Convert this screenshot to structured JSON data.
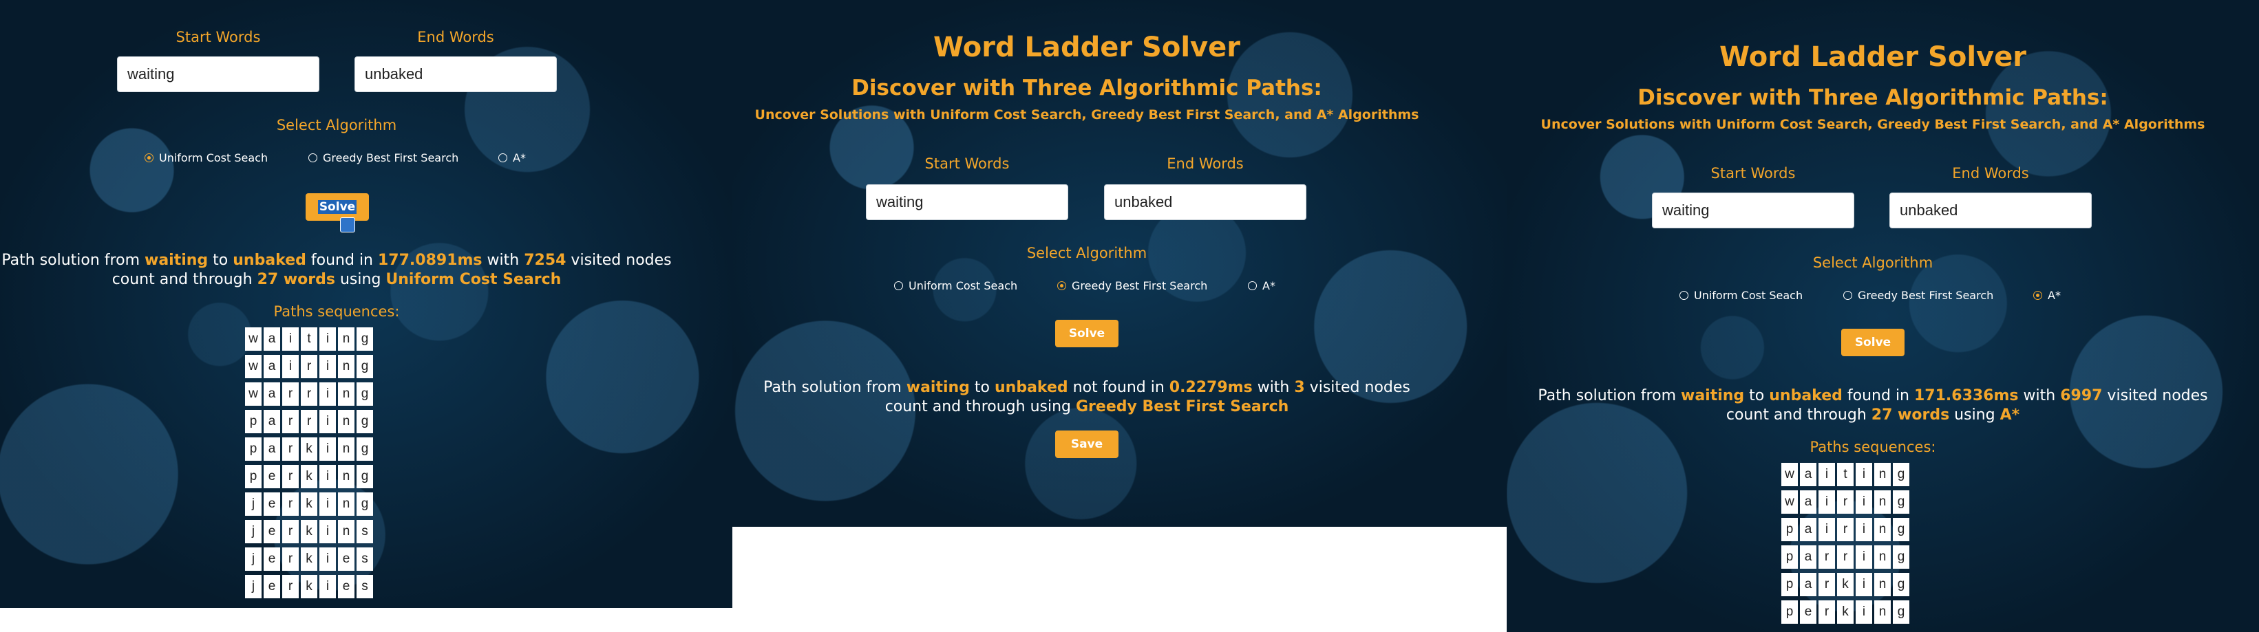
{
  "panel1": {
    "start_label": "Start Words",
    "end_label": "End Words",
    "start_value": "waiting",
    "end_value": "unbaked",
    "select_label": "Select Algorithm",
    "radios": [
      {
        "label": "Uniform Cost Seach",
        "checked": true
      },
      {
        "label": "Greedy Best First Search",
        "checked": false
      },
      {
        "label": "A*",
        "checked": false
      }
    ],
    "solve_label": "Solve",
    "result": {
      "t1": "Path solution from ",
      "start": "waiting",
      "t2": " to ",
      "end": "unbaked",
      "t3": " found in ",
      "time": "177.0891ms",
      "t4": " with ",
      "nodes": "7254",
      "t5": " visited nodes",
      "t6": "count and through ",
      "words": "27 words",
      "t7": " using ",
      "algo": "Uniform Cost Search"
    },
    "seq_label": "Paths sequences:",
    "sequences": [
      "waiting",
      "wairing",
      "warring",
      "parring",
      "parking",
      "perking",
      "jerking",
      "jerkins",
      "jerkies",
      "jerkies"
    ]
  },
  "panel2": {
    "title": "Word Ladder Solver",
    "subtitle": "Discover with Three Algorithmic Paths:",
    "tagline": "Uncover Solutions with Uniform Cost Search, Greedy Best First Search, and A* Algorithms",
    "start_label": "Start Words",
    "end_label": "End Words",
    "start_value": "waiting",
    "end_value": "unbaked",
    "select_label": "Select Algorithm",
    "radios": [
      {
        "label": "Uniform Cost Seach",
        "checked": false
      },
      {
        "label": "Greedy Best First Search",
        "checked": true
      },
      {
        "label": "A*",
        "checked": false
      }
    ],
    "solve_label": "Solve",
    "result": {
      "t1": "Path solution from ",
      "start": "waiting",
      "t2": " to ",
      "end": "unbaked",
      "t3": " not found in ",
      "time": "0.2279ms",
      "t4": " with ",
      "nodes": "3",
      "t5": " visited nodes",
      "t6": "count and through using ",
      "algo": "Greedy Best First Search"
    },
    "save_label": "Save"
  },
  "panel3": {
    "title": "Word Ladder Solver",
    "subtitle": "Discover with Three Algorithmic Paths:",
    "tagline": "Uncover Solutions with Uniform Cost Search, Greedy Best First Search, and A* Algorithms",
    "start_label": "Start Words",
    "end_label": "End Words",
    "start_value": "waiting",
    "end_value": "unbaked",
    "select_label": "Select Algorithm",
    "radios": [
      {
        "label": "Uniform Cost Seach",
        "checked": false
      },
      {
        "label": "Greedy Best First Search",
        "checked": false
      },
      {
        "label": "A*",
        "checked": true
      }
    ],
    "solve_label": "Solve",
    "result": {
      "t1": "Path solution from ",
      "start": "waiting",
      "t2": " to ",
      "end": "unbaked",
      "t3": " found in ",
      "time": "171.6336ms",
      "t4": " with ",
      "nodes": "6997",
      "t5": " visited nodes",
      "t6": "count and through ",
      "words": "27 words",
      "t7": " using ",
      "algo": "A*"
    },
    "seq_label": "Paths sequences:",
    "sequences": [
      "waiting",
      "wairing",
      "pairing",
      "parring",
      "parking",
      "perking"
    ]
  },
  "colors": {
    "accent": "#f4a62a",
    "background": "#08253c"
  }
}
